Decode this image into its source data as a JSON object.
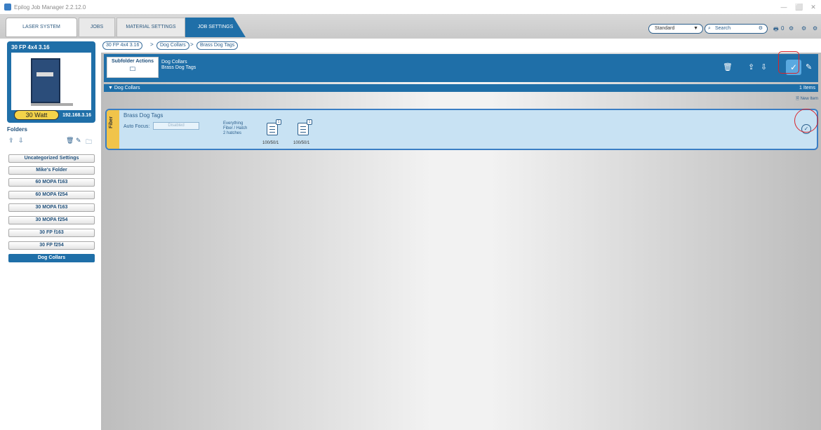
{
  "window": {
    "title": "Epilog Job Manager 2.2.12.0",
    "controls": [
      "—",
      "⬜",
      "✕"
    ]
  },
  "tabs": {
    "laser_system": "LASER SYSTEM",
    "jobs": "JOBS",
    "material_settings": "MATERIAL SETTINGS",
    "job_settings": "JOB SETTINGS"
  },
  "toolbar": {
    "mode_value": "Standard",
    "search_placeholder": "Search",
    "print_queue_count": "0"
  },
  "machine": {
    "name": "30 FP 4x4 3.16",
    "wattage": "30 Watt",
    "ip": "192.168.3.16"
  },
  "folders": {
    "heading": "Folders",
    "items": [
      {
        "label": "Uncategorized Settings"
      },
      {
        "label": "Mike's Folder"
      },
      {
        "label": "60 MOPA f163"
      },
      {
        "label": "60 MOPA f254"
      },
      {
        "label": "30 MOPA f163"
      },
      {
        "label": "30 MOPA f254"
      },
      {
        "label": "30 FP f163"
      },
      {
        "label": "30 FP f254"
      },
      {
        "label": "Dog Collars",
        "active": true
      }
    ]
  },
  "breadcrumb": [
    "30 FP 4x4 3.16",
    "Dog Collars",
    "Brass Dog Tags"
  ],
  "action_bar": {
    "subfolder_actions": "Subfolder Actions",
    "folder_line1": "Dog Collars",
    "folder_line2": "Brass Dog Tags"
  },
  "group": {
    "title": "▼ Dog Collars",
    "count": "1 Items",
    "new_item": "New Item"
  },
  "item": {
    "title": "Brass Dog Tags",
    "process_tag": "Fiber",
    "auto_focus_label": "Auto Focus:",
    "auto_focus_value": "Disabled",
    "process_line1": "Everything",
    "process_line2": "Fiber / Hatch",
    "process_line3": "2 hatches",
    "passes": [
      {
        "num": "1",
        "value": "100/50/1"
      },
      {
        "num": "1",
        "value": "100/50/1"
      }
    ]
  },
  "colors": {
    "accent": "#1f6fa8",
    "highlight_ring": "#d9242b",
    "fiber_tag": "#f1c44a",
    "card_bg": "#c8e2f3"
  }
}
